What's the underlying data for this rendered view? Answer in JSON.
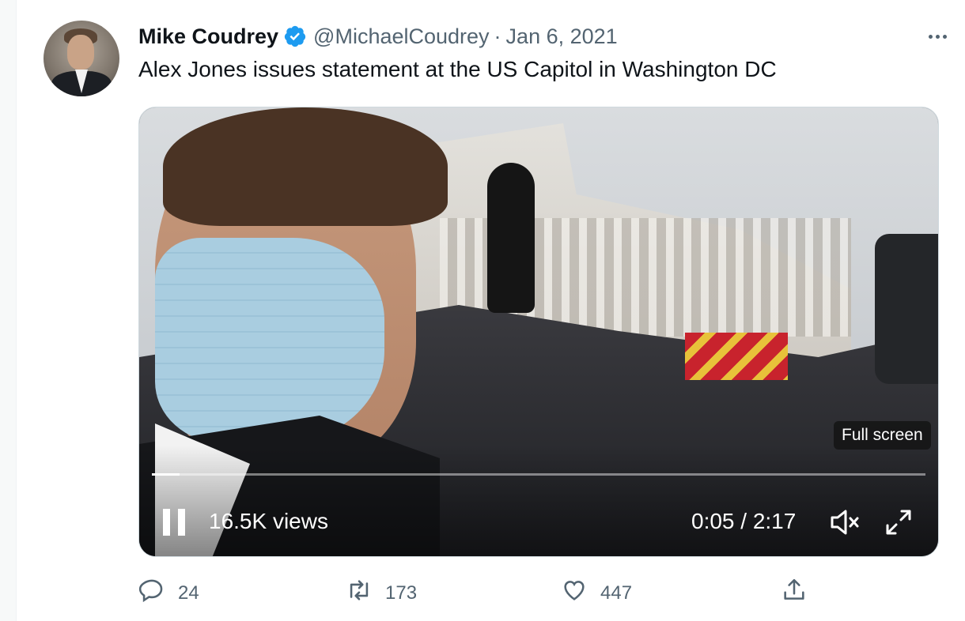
{
  "tweet": {
    "author_name": "Mike Coudrey",
    "handle": "@MichaelCoudrey",
    "separator": "·",
    "date": "Jan 6, 2021",
    "text": "Alex Jones issues statement at the US Capitol in Washington DC",
    "verified_icon": "verified-badge-icon",
    "more_icon": "more-options-icon"
  },
  "video": {
    "views": "16.5K views",
    "time": "0:05 / 2:17",
    "tooltip": "Full screen",
    "progress": 0.036,
    "play_state_icon": "pause-icon",
    "mute_icon": "muted-speaker-icon",
    "fullscreen_icon": "fullscreen-icon"
  },
  "actions": {
    "replies": "24",
    "retweets": "173",
    "likes": "447",
    "reply_icon": "reply-icon",
    "retweet_icon": "retweet-icon",
    "like_icon": "heart-icon",
    "share_icon": "share-icon"
  },
  "colors": {
    "verified": "#1d9bf0",
    "text_primary": "#0f1419",
    "text_secondary": "#536471"
  }
}
